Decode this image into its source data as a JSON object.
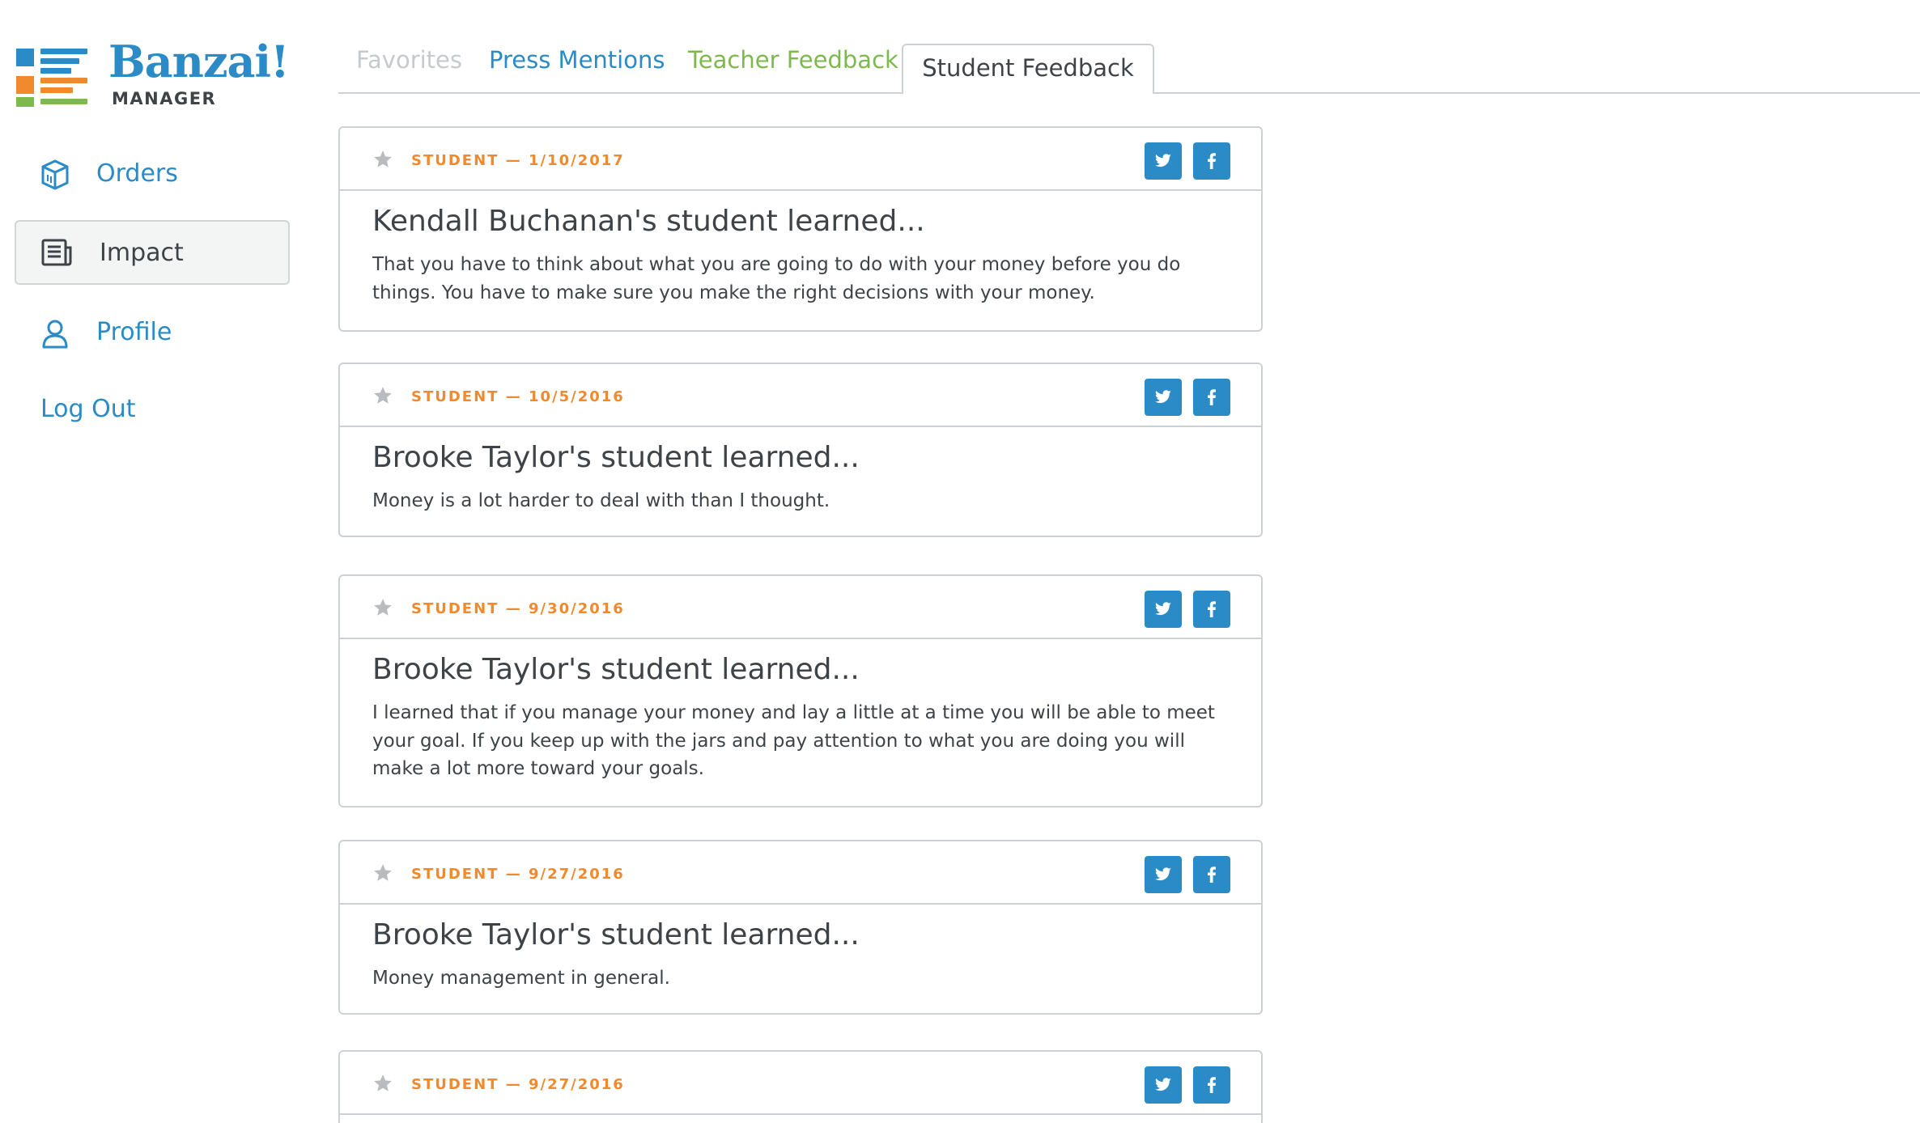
{
  "brand": {
    "name": "Banzai!",
    "subtitle": "MANAGER",
    "colors": {
      "blue": "#2b8bc6",
      "orange": "#f08a2c",
      "green": "#7db94d",
      "gray": "#3d4347"
    }
  },
  "sidebar": {
    "items": [
      {
        "label": "Orders",
        "icon": "box-icon",
        "active": false
      },
      {
        "label": "Impact",
        "icon": "newspaper-icon",
        "active": true
      },
      {
        "label": "Profile",
        "icon": "user-icon",
        "active": false
      }
    ],
    "logout_label": "Log Out"
  },
  "tabs": [
    {
      "label": "Favorites",
      "active": false
    },
    {
      "label": "Press Mentions",
      "active": false
    },
    {
      "label": "Teacher Feedback",
      "active": false
    },
    {
      "label": "Student Feedback",
      "active": true
    }
  ],
  "feedback": [
    {
      "meta": "STUDENT — 1/10/2017",
      "title": "Kendall Buchanan's student learned...",
      "text": "That you have to think about what you are going to do with your money before you do things. You have to make sure you make the right decisions with your money."
    },
    {
      "meta": "STUDENT — 10/5/2016",
      "title": "Brooke Taylor's student learned...",
      "text": "Money is a lot harder to deal with than I thought."
    },
    {
      "meta": "STUDENT — 9/30/2016",
      "title": "Brooke Taylor's student learned...",
      "text": "I learned that if you manage your money and lay a little at a time you will be able to meet your goal. If you keep up with the jars and pay attention to what you are doing you will make a lot more toward your goals."
    },
    {
      "meta": "STUDENT — 9/27/2016",
      "title": "Brooke Taylor's student learned...",
      "text": "Money management in general."
    },
    {
      "meta": "STUDENT — 9/27/2016",
      "title": "",
      "text": ""
    }
  ]
}
